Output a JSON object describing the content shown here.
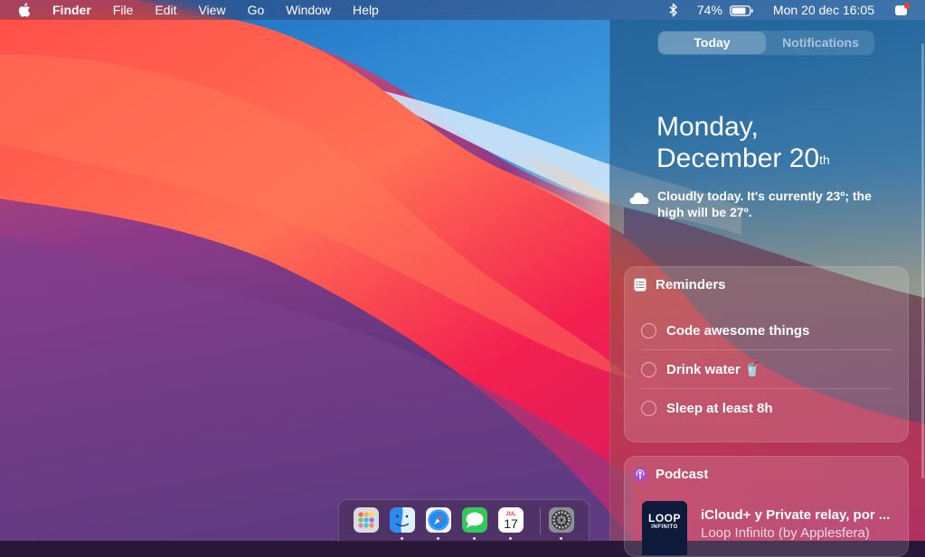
{
  "menubar": {
    "app_name": "Finder",
    "items": [
      "File",
      "Edit",
      "View",
      "Go",
      "Window",
      "Help"
    ],
    "battery_percent": "74%",
    "clock": "Mon 20 dec 16:05",
    "icons": [
      "apple-icon",
      "bluetooth-icon",
      "battery-icon",
      "notification-center-icon"
    ]
  },
  "notification_center": {
    "tabs": {
      "today": "Today",
      "notifications": "Notifications",
      "active": "today"
    },
    "date_line1": "Monday,",
    "date_line2": "December 20",
    "date_suffix": "th",
    "weather": {
      "icon": "cloud-icon",
      "text": "Cloudly today. It's currently 23º; the high will be 27º."
    },
    "reminders": {
      "title": "Reminders",
      "icon": "list-icon",
      "items": [
        {
          "label": "Code awesome things"
        },
        {
          "label": "Drink water 🥤"
        },
        {
          "label": "Sleep at least 8h"
        }
      ]
    },
    "podcast": {
      "title": "Podcast",
      "icon": "podcast-icon",
      "art_line1": "LOOP",
      "art_line2": "INFINITO",
      "episode_title": "iCloud+ y Private relay, por ...",
      "author": "Loop Infinito (by Applesfera)"
    }
  },
  "dock": {
    "apps": [
      "launchpad",
      "finder",
      "safari",
      "messages",
      "calendar",
      "system-preferences"
    ],
    "calendar_month": "JUL",
    "calendar_day": "17"
  },
  "colors": {
    "accent_red": "#f5104a",
    "sky_blue": "#3a8fd0",
    "wallpaper_purple": "#5a3a78"
  }
}
